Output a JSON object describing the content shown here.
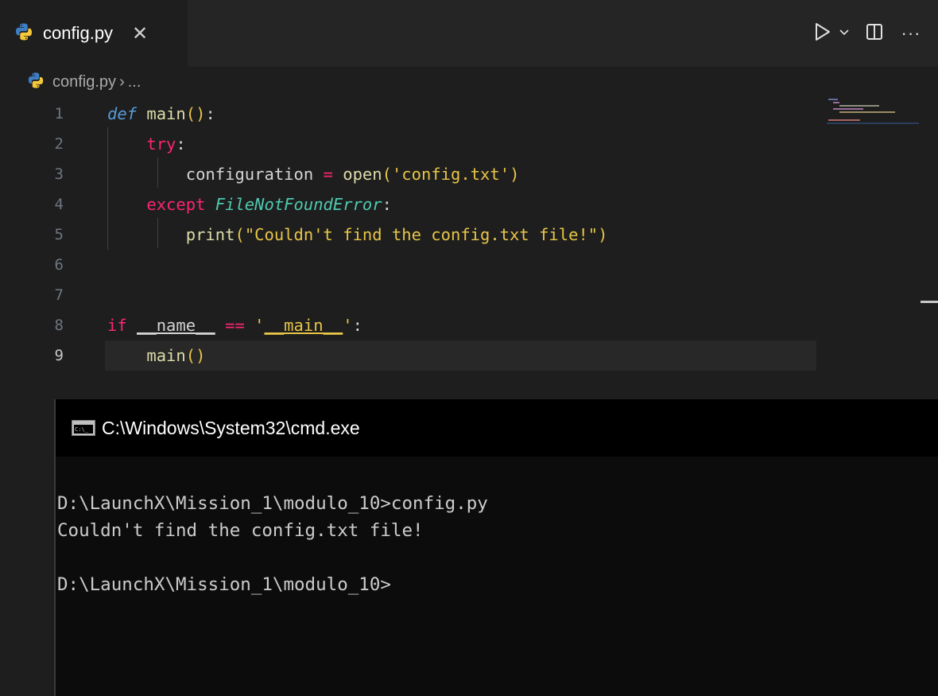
{
  "tabbar": {
    "tab_label": "config.py",
    "close_glyph": "✕",
    "actions": {
      "run_icon": "run-triangle-icon",
      "dropdown_glyph": "⌄",
      "split_icon": "split-editor-icon",
      "more_glyph": "···"
    }
  },
  "breadcrumb": {
    "file": "config.py",
    "separator": "›",
    "more": "..."
  },
  "editor": {
    "line_numbers": [
      "1",
      "2",
      "3",
      "4",
      "5",
      "6",
      "7",
      "8",
      "9"
    ],
    "active_line": "9"
  },
  "terminal": {
    "title": "C:\\Windows\\System32\\cmd.exe",
    "lines": [
      "D:\\LaunchX\\Mission_1\\modulo_10>config.py",
      "Couldn't find the config.txt file!",
      "",
      "D:\\LaunchX\\Mission_1\\modulo_10>"
    ]
  },
  "colors": {
    "editor_bg": "#1e1e1e",
    "tab_bg": "#252526",
    "terminal_bg": "#0c0c0c",
    "keyword": "#c586c0",
    "function": "#dcdcaa",
    "string": "#ce9178"
  }
}
